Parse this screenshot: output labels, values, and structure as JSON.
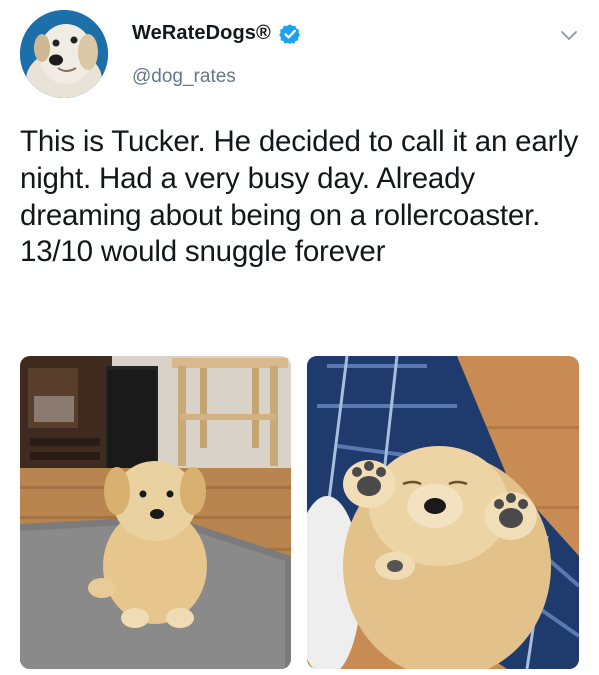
{
  "account": {
    "display_name": "WeRateDogs®",
    "handle": "@dog_rates",
    "verified": true
  },
  "tweet": {
    "text": "This is Tucker. He decided to call it an early night. Had a very busy day. Already dreaming about being on a rollercoaster. 13/10 would snuggle forever"
  },
  "media": [
    {
      "name": "puppy-sitting-on-rug-photo"
    },
    {
      "name": "puppy-sleeping-on-back-photo"
    }
  ],
  "icons": {
    "verified": "verified-badge-icon",
    "menu": "chevron-down-icon"
  },
  "colors": {
    "text": "#14171a",
    "secondary_text": "#657786",
    "verified_blue": "#1da1f2"
  }
}
